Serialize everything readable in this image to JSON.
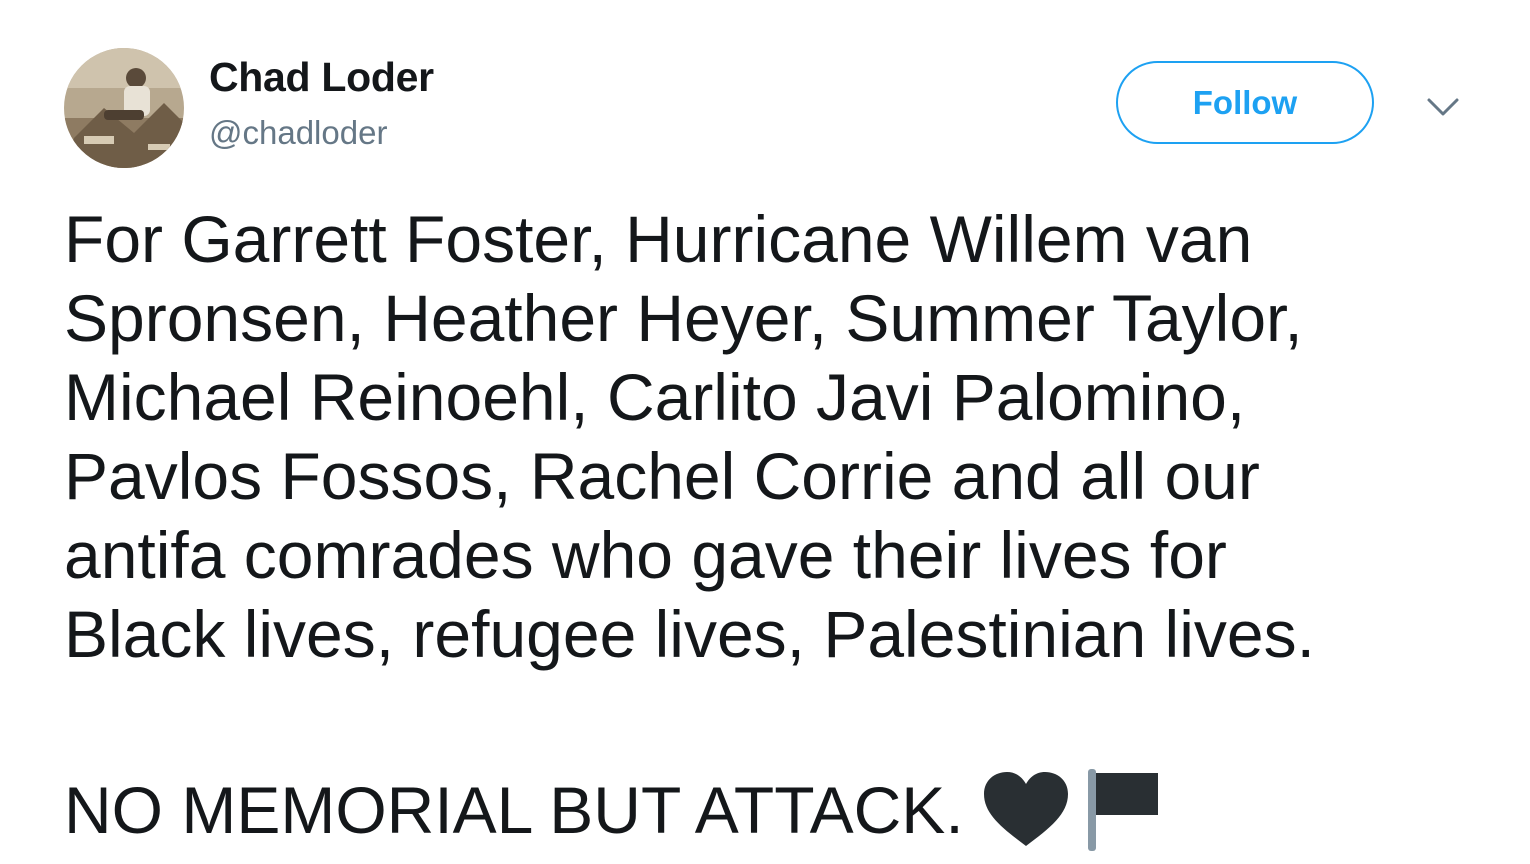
{
  "tweet": {
    "author": {
      "display_name": "Chad Loder",
      "handle": "@chadloder"
    },
    "follow_label": "Follow",
    "menu_icon": "chevron-down-icon",
    "text_lines": [
      "For Garrett Foster, Hurricane Willem van",
      "Spronsen, Heather Heyer, Summer Taylor,",
      "Michael Reinoehl, Carlito Javi Palomino,",
      "Pavlos Fossos, Rachel Corrie and all our",
      "antifa comrades who gave their lives for",
      "Black lives, refugee lives, Palestinian lives."
    ],
    "slogan": "NO MEMORIAL BUT ATTACK.",
    "emojis": [
      "black-heart-icon",
      "black-flag-icon"
    ]
  },
  "colors": {
    "accent": "#1da1f2",
    "text": "#14171a",
    "secondary_text": "#657786",
    "emoji_dark": "#292f33"
  }
}
